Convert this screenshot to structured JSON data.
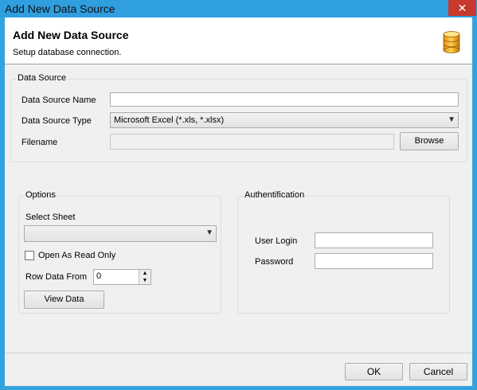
{
  "window": {
    "title": "Add New Data Source",
    "close_glyph": "✕"
  },
  "header": {
    "title": "Add New Data Source",
    "subtitle": "Setup database connection.",
    "icon": "database-icon"
  },
  "data_source": {
    "group_label": "Data Source",
    "name_label": "Data Source Name",
    "name_value": "",
    "type_label": "Data Source Type",
    "type_value": "Microsoft Excel (*.xls, *.xlsx)",
    "filename_label": "Filename",
    "filename_value": "",
    "browse_label": "Browse"
  },
  "options": {
    "group_label": "Options",
    "select_sheet_label": "Select Sheet",
    "select_sheet_value": "",
    "read_only_label": "Open As Read Only",
    "read_only_checked": false,
    "row_data_from_label": "Row Data From",
    "row_data_from_value": "0",
    "view_data_label": "View Data"
  },
  "auth": {
    "group_label": "Authentification",
    "user_login_label": "User Login",
    "user_login_value": "",
    "password_label": "Password",
    "password_value": ""
  },
  "footer": {
    "ok_label": "OK",
    "cancel_label": "Cancel"
  },
  "colors": {
    "titlebar": "#2f9fe0",
    "close": "#c8392b",
    "client": "#f0f0f0"
  }
}
